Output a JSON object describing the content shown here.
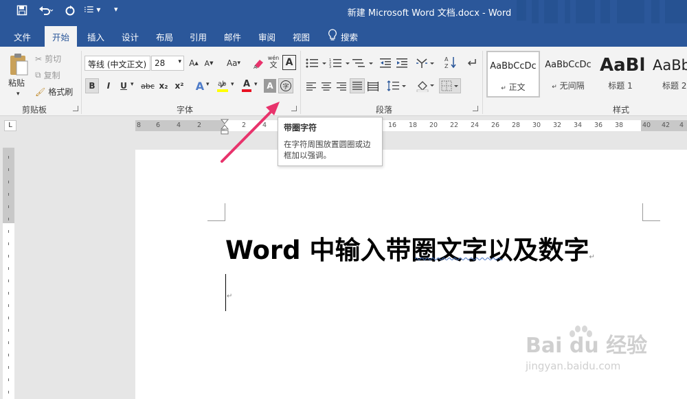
{
  "title_bar": {
    "title": "新建 Microsoft Word 文档.docx  -  Word"
  },
  "tabs": [
    "文件",
    "开始",
    "插入",
    "设计",
    "布局",
    "引用",
    "邮件",
    "审阅",
    "视图"
  ],
  "tell_me": "搜索",
  "clipboard": {
    "paste": "粘贴",
    "cut": "剪切",
    "copy": "复制",
    "format_painter": "格式刷",
    "label": "剪贴板"
  },
  "font": {
    "name": "等线 (中文正文)",
    "size": "28",
    "label": "字体",
    "case_label": "Aa",
    "phonetic_top": "wén",
    "phonetic_bottom": "文",
    "bold": "B",
    "italic": "I",
    "underline": "U",
    "strike": "abc",
    "sub": "x₂",
    "sup": "x²",
    "enclose_char": "字"
  },
  "paragraph": {
    "label": "段落"
  },
  "styles": {
    "label": "样式",
    "items": [
      {
        "preview": "AaBbCcDc",
        "name": "正文"
      },
      {
        "preview": "AaBbCcDc",
        "name": "无间隔"
      },
      {
        "preview": "AaBl",
        "name": "标题 1"
      },
      {
        "preview": "AaBb",
        "name": "标题 2"
      }
    ]
  },
  "ruler": {
    "ticks": [
      "8",
      "6",
      "4",
      "2",
      "",
      "2",
      "4",
      "",
      "",
      "",
      "",
      "",
      "",
      "16",
      "18",
      "20",
      "22",
      "24",
      "26",
      "28",
      "30",
      "32",
      "34",
      "36",
      "38",
      "40",
      "42",
      "4"
    ],
    "corner": "L"
  },
  "tooltip": {
    "title": "带圈字符",
    "body": "在字符周围放置圆圈或边框加以强调。"
  },
  "document": {
    "heading": "Word 中输入带圈文字以及数字"
  },
  "watermark": {
    "brand": "Bai du 经验",
    "url": "jingyan.baidu.com"
  },
  "colors": {
    "brand": "#2b579a",
    "accent_arrow": "#e8336c"
  }
}
